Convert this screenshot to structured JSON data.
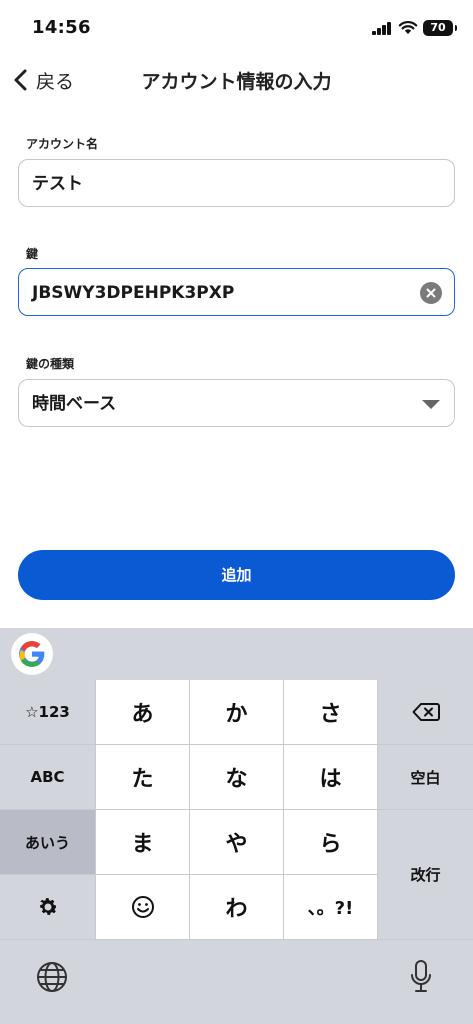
{
  "status_bar": {
    "time": "14:56",
    "battery": "70"
  },
  "nav": {
    "back_label": "戻る",
    "title": "アカウント情報の入力"
  },
  "form": {
    "account_name": {
      "label": "アカウント名",
      "value": "テスト"
    },
    "secret_key": {
      "label": "鍵",
      "value": "JBSWY3DPEHPK3PXP"
    },
    "key_type": {
      "label": "鍵の種類",
      "value": "時間ベース"
    }
  },
  "add_button": {
    "label": "追加"
  },
  "colors": {
    "accent": "#0a5ad4",
    "focus_border": "#1a66d6",
    "keyboard_bg": "#d3d5dc"
  },
  "keyboard": {
    "left_keys": [
      "☆123",
      "ABC",
      "あいう"
    ],
    "kana_keys": [
      "あ",
      "か",
      "さ",
      "た",
      "な",
      "は",
      "ま",
      "や",
      "ら",
      "わ",
      "、。?!"
    ],
    "right_keys": {
      "space": "空白",
      "enter": "改行"
    },
    "icons": [
      "google-icon",
      "backspace-icon",
      "settings-gear-icon",
      "emoji-icon",
      "globe-icon",
      "microphone-icon"
    ]
  }
}
